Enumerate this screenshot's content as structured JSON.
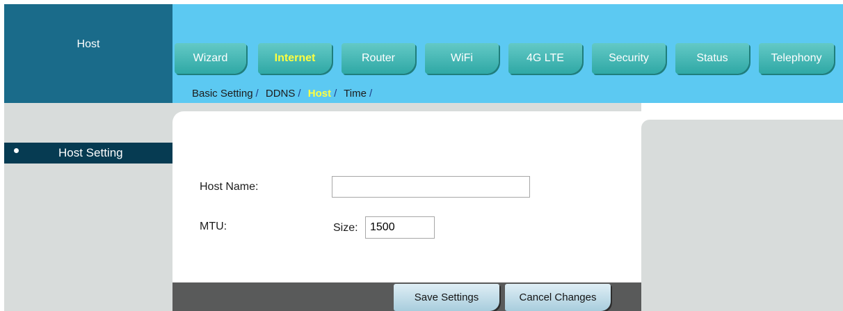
{
  "section": {
    "title": "Host"
  },
  "nav": {
    "tabs": [
      {
        "label": "Wizard",
        "active": false
      },
      {
        "label": "Internet",
        "active": true
      },
      {
        "label": "Router",
        "active": false
      },
      {
        "label": "WiFi",
        "active": false
      },
      {
        "label": "4G LTE",
        "active": false
      },
      {
        "label": "Security",
        "active": false
      },
      {
        "label": "Status",
        "active": false
      },
      {
        "label": "Telephony",
        "active": false
      }
    ],
    "subnav": [
      {
        "label": "Basic Setting",
        "active": false
      },
      {
        "label": "DDNS",
        "active": false
      },
      {
        "label": "Host",
        "active": true
      },
      {
        "label": "Time",
        "active": false
      }
    ],
    "separator": "/"
  },
  "sidebar": {
    "items": [
      {
        "label": "Host Setting",
        "active": true
      }
    ]
  },
  "form": {
    "host_name_label": "Host Name:",
    "host_name_value": "",
    "mtu_label": "MTU:",
    "size_label": "Size:",
    "mtu_value": "1500"
  },
  "actions": {
    "save_label": "Save Settings",
    "cancel_label": "Cancel Changes"
  },
  "colors": {
    "header_bg": "#5cc9f2",
    "section_bg": "#1a6b8a",
    "tab_bg": "#2fa8a5",
    "active_text": "#ffff40",
    "sidebar_item_bg": "#063b52",
    "panel_bg": "#d8dcdb",
    "bottom_bar_bg": "#595a5a"
  }
}
